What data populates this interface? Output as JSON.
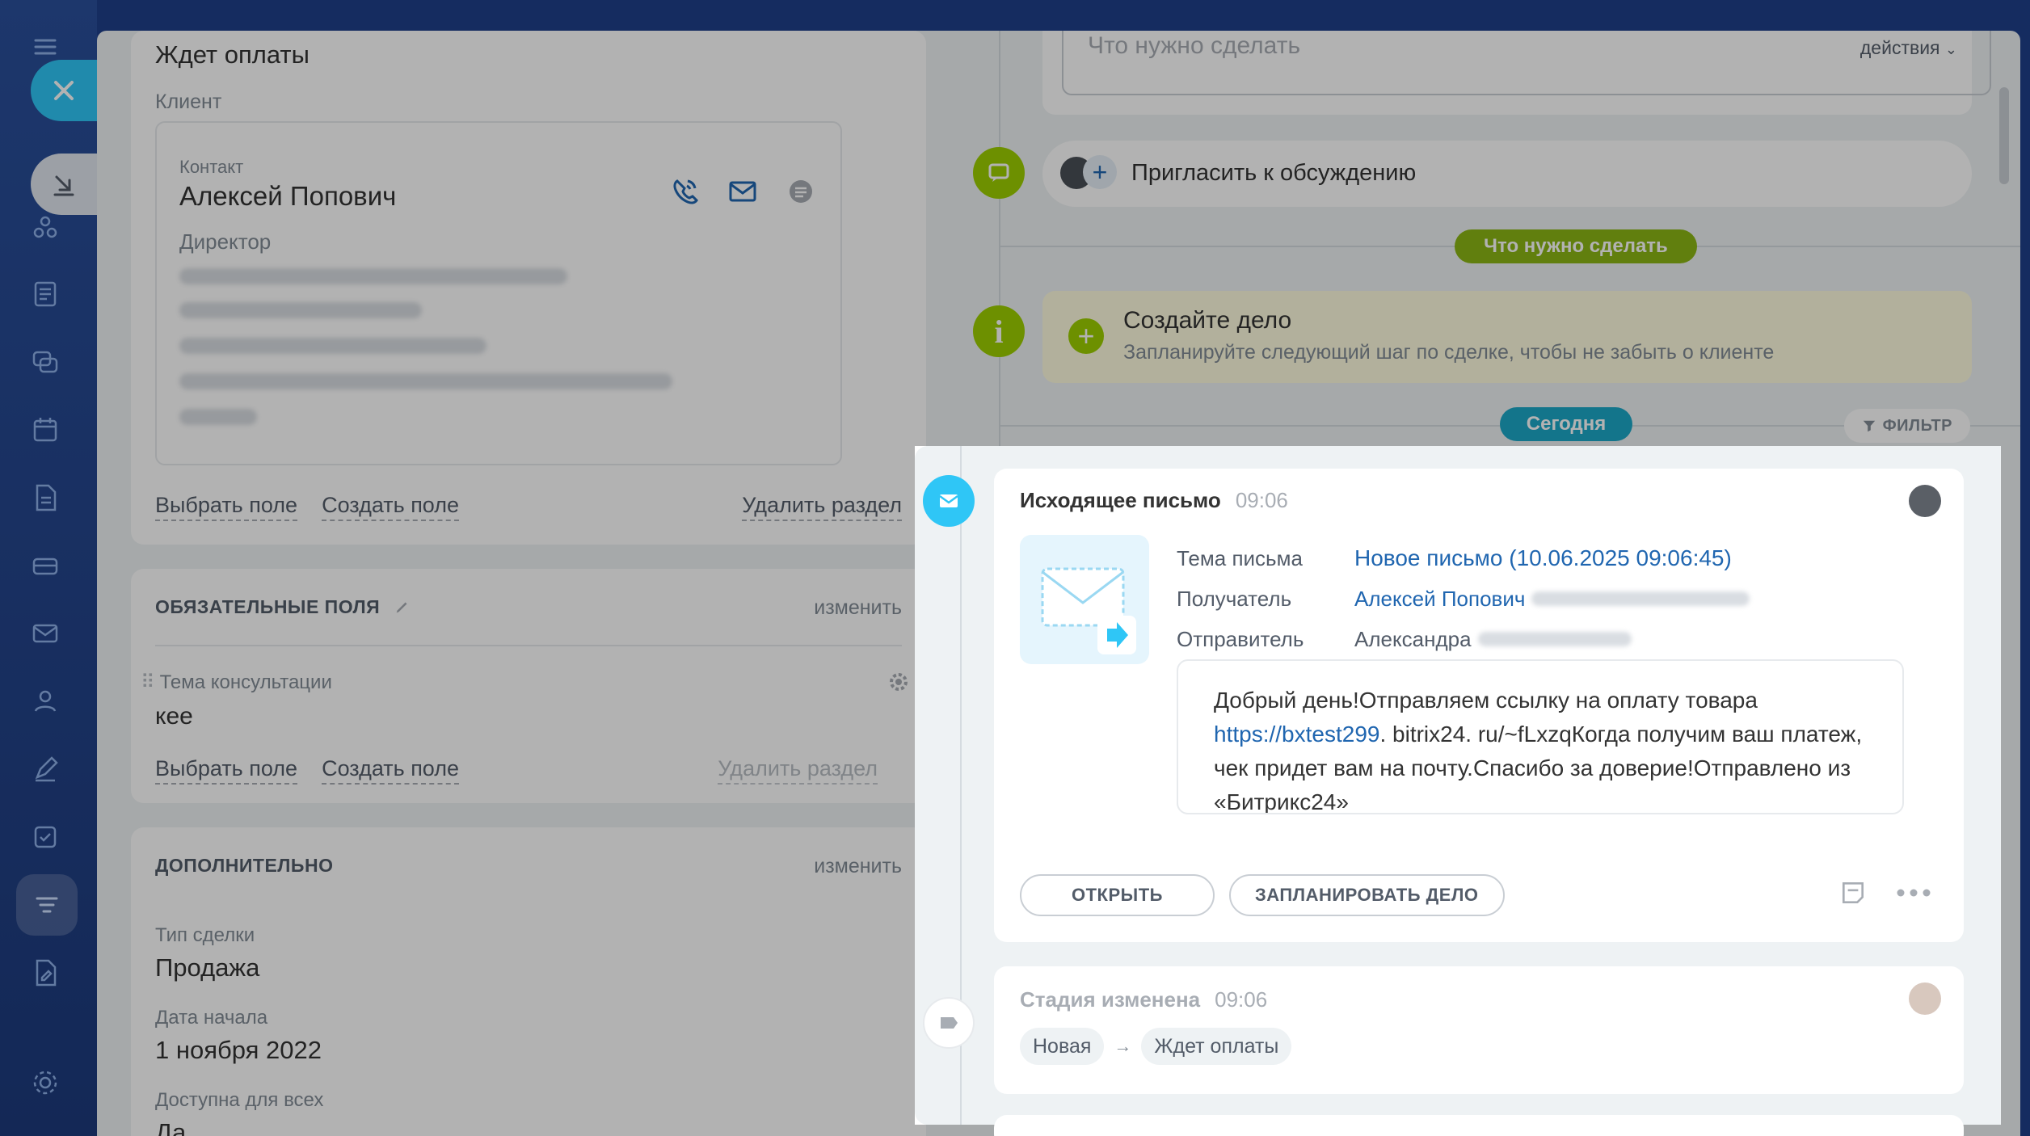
{
  "left": {
    "status": "Ждет оплаты",
    "client_label": "Клиент",
    "contact": {
      "type_label": "Контакт",
      "name": "Алексей Попович",
      "role": "Директор"
    },
    "client_actions": {
      "choose_field": "Выбрать поле",
      "create_field": "Создать поле",
      "delete_section": "Удалить раздел"
    },
    "required": {
      "title": "ОБЯЗАТЕЛЬНЫЕ ПОЛЯ",
      "edit": "изменить",
      "field_label": "Тема консультации",
      "field_value": "кее",
      "choose_field": "Выбрать поле",
      "create_field": "Создать поле",
      "delete_section": "Удалить раздел"
    },
    "additional": {
      "title": "ДОПОЛНИТЕЛЬНО",
      "edit": "изменить",
      "fields": [
        {
          "label": "Тип сделки",
          "value": "Продажа"
        },
        {
          "label": "Дата начала",
          "value": "1 ноября 2022"
        },
        {
          "label": "Доступна для всех",
          "value": "Да"
        }
      ]
    }
  },
  "timeline": {
    "todo_placeholder": "Что нужно сделать",
    "todo_actions": "действия",
    "invite": "Пригласить к обсуждению",
    "todo_pill": "Что нужно сделать",
    "create": {
      "title": "Создайте дело",
      "subtitle": "Запланируйте следующий шаг по сделке, чтобы не забыть о клиенте"
    },
    "today_pill": "Сегодня",
    "filter": "ФИЛЬТР",
    "email": {
      "title": "Исходящее письмо",
      "time": "09:06",
      "subject_label": "Тема письма",
      "subject": "Новое письмо (10.06.2025 09:06:45)",
      "recipient_label": "Получатель",
      "recipient": "Алексей Попович",
      "sender_label": "Отправитель",
      "sender": "Александра",
      "body_pre": "Добрый день!Отправляем ссылку на оплату товара ",
      "body_link": "https://bxtest299",
      "body_post": ". bitrix24. ru/~fLxzqКогда получим ваш платеж, чек придет вам на почту.Спасибо за доверие!Отправлено из «Битрикс24»",
      "open_button": "ОТКРЫТЬ",
      "plan_button": "ЗАПЛАНИРОВАТЬ ДЕЛО"
    },
    "stage": {
      "title": "Стадия изменена",
      "time": "09:06",
      "from": "Новая",
      "to": "Ждет оплаты"
    }
  },
  "colors": {
    "accent_blue": "#2fc6f6",
    "accent_green": "#9dcf00",
    "link": "#2066b0"
  }
}
